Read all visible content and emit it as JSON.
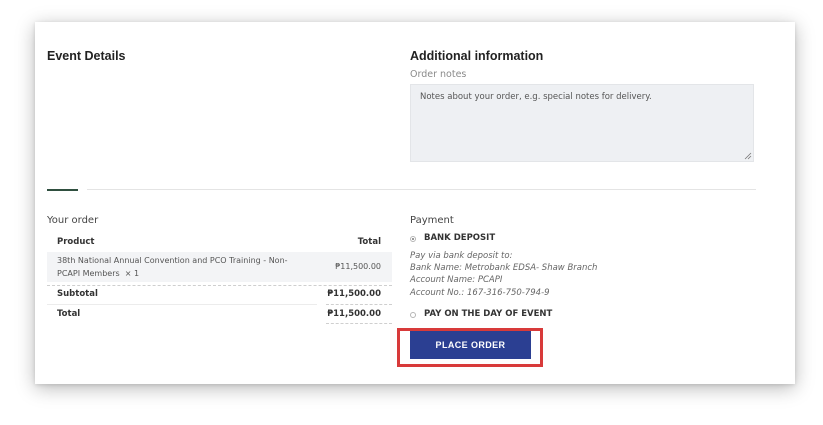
{
  "event_details": {
    "title": "Event Details"
  },
  "additional_info": {
    "title": "Additional information",
    "order_notes_label": "Order notes",
    "order_notes_placeholder": "Notes about your order, e.g. special notes for delivery."
  },
  "order": {
    "title": "Your order",
    "columns": {
      "product": "Product",
      "total": "Total"
    },
    "items": [
      {
        "name_line1": "38th National Annual Convention and PCO Training - Non-",
        "name_line2": "PCAPI Members",
        "qty": "× 1",
        "total": "₱11,500.00"
      }
    ],
    "subtotal_label": "Subtotal",
    "subtotal_value": "₱11,500.00",
    "total_label": "Total",
    "total_value": "₱11,500.00"
  },
  "payment": {
    "title": "Payment",
    "methods": [
      {
        "label": "BANK DEPOSIT",
        "selected": true,
        "description": [
          "Pay via bank deposit to:",
          "Bank Name: Metrobank EDSA- Shaw Branch",
          "Account Name: PCAPI",
          "Account No.: 167-316-750-794-9"
        ]
      },
      {
        "label": "PAY ON THE DAY OF EVENT",
        "selected": false
      }
    ],
    "place_order_label": "PLACE ORDER"
  },
  "colors": {
    "button": "#2b3f92",
    "highlight": "#d83a3a",
    "tab_active": "#2f4f3f"
  }
}
